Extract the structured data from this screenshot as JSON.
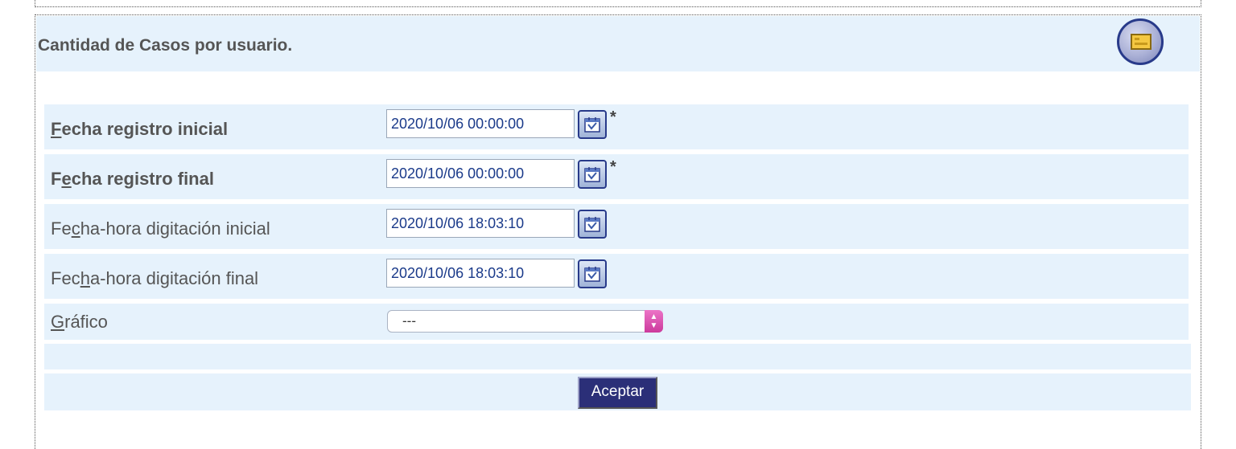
{
  "header": {
    "title": "Cantidad de Casos por usuario.",
    "icon": "report-icon"
  },
  "fields": [
    {
      "label_pre": "",
      "label_key": "F",
      "label_post": "echa registro inicial",
      "value": "2020/10/06 00:00:00",
      "required": "*",
      "icon": "calendar-icon"
    },
    {
      "label_pre": "F",
      "label_key": "e",
      "label_post": "cha registro final",
      "value": "2020/10/06 00:00:00",
      "required": "*",
      "icon": "calendar-icon"
    },
    {
      "label_pre": "Fe",
      "label_key": "c",
      "label_post": "ha-hora digitación inicial",
      "value": "2020/10/06 18:03:10",
      "required": "",
      "icon": "calendar-icon"
    },
    {
      "label_pre": "Fec",
      "label_key": "h",
      "label_post": "a-hora digitación final",
      "value": "2020/10/06 18:03:10",
      "required": "",
      "icon": "calendar-icon"
    }
  ],
  "chart_select": {
    "label_key": "G",
    "label_post": "ráfico",
    "selected": "---"
  },
  "actions": {
    "accept_label": "Aceptar"
  },
  "colors": {
    "row_background": "#e6f2fc",
    "input_text": "#1a3a8a",
    "button_background": "#2b2f78",
    "select_arrow": "#d94fb0"
  }
}
